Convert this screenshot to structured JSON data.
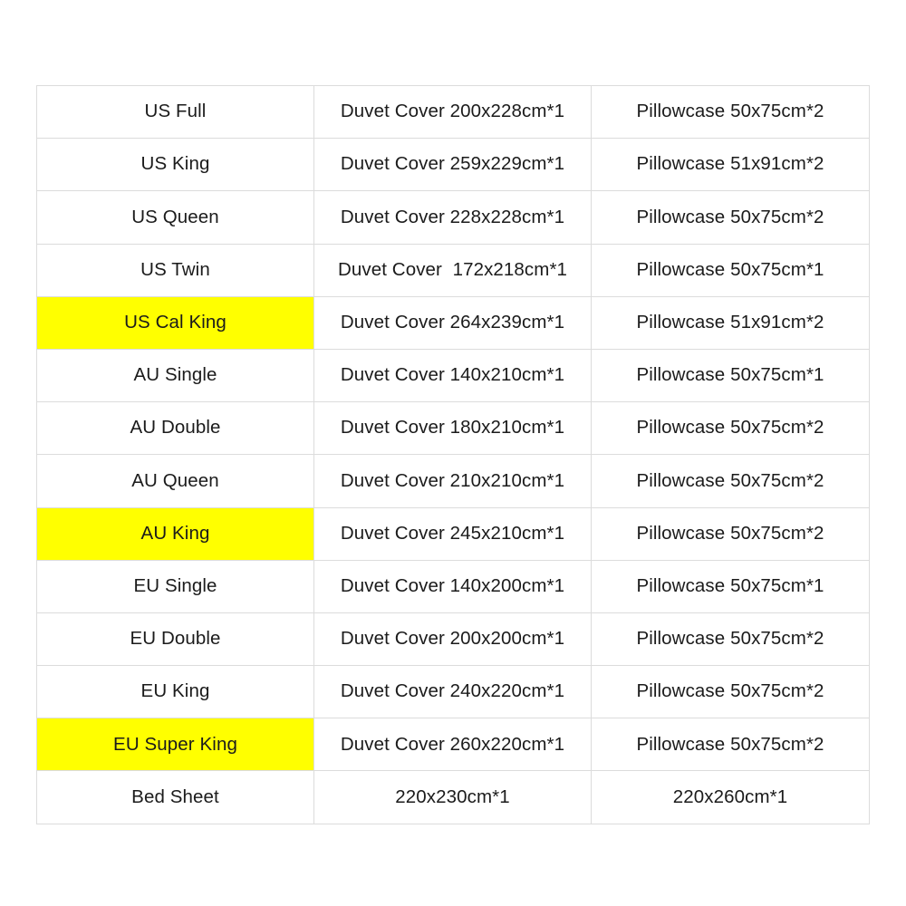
{
  "table": {
    "highlight_color": "#ffff00",
    "border_color": "#dcdcdc",
    "text_color": "#1b1b1b",
    "columns": [
      "size",
      "duvet_cover",
      "pillowcase"
    ],
    "rows": [
      {
        "size": "US Full",
        "duvet_cover": "Duvet Cover 200x228cm*1",
        "pillowcase": "Pillowcase 50x75cm*2",
        "highlighted": false
      },
      {
        "size": "US King",
        "duvet_cover": "Duvet Cover 259x229cm*1",
        "pillowcase": "Pillowcase 51x91cm*2",
        "highlighted": false
      },
      {
        "size": "US Queen",
        "duvet_cover": "Duvet Cover 228x228cm*1",
        "pillowcase": "Pillowcase 50x75cm*2",
        "highlighted": false
      },
      {
        "size": "US Twin",
        "duvet_cover": "Duvet Cover  172x218cm*1",
        "pillowcase": "Pillowcase 50x75cm*1",
        "highlighted": false
      },
      {
        "size": "US Cal King",
        "duvet_cover": "Duvet Cover 264x239cm*1",
        "pillowcase": "Pillowcase 51x91cm*2",
        "highlighted": true
      },
      {
        "size": "AU Single",
        "duvet_cover": "Duvet Cover 140x210cm*1",
        "pillowcase": "Pillowcase 50x75cm*1",
        "highlighted": false
      },
      {
        "size": "AU Double",
        "duvet_cover": "Duvet Cover 180x210cm*1",
        "pillowcase": "Pillowcase 50x75cm*2",
        "highlighted": false
      },
      {
        "size": "AU Queen",
        "duvet_cover": "Duvet Cover 210x210cm*1",
        "pillowcase": "Pillowcase 50x75cm*2",
        "highlighted": false
      },
      {
        "size": "AU King",
        "duvet_cover": "Duvet Cover 245x210cm*1",
        "pillowcase": "Pillowcase 50x75cm*2",
        "highlighted": true
      },
      {
        "size": "EU Single",
        "duvet_cover": "Duvet Cover 140x200cm*1",
        "pillowcase": "Pillowcase 50x75cm*1",
        "highlighted": false
      },
      {
        "size": "EU Double",
        "duvet_cover": "Duvet Cover 200x200cm*1",
        "pillowcase": "Pillowcase 50x75cm*2",
        "highlighted": false
      },
      {
        "size": "EU King",
        "duvet_cover": "Duvet Cover 240x220cm*1",
        "pillowcase": "Pillowcase 50x75cm*2",
        "highlighted": false
      },
      {
        "size": "EU Super King",
        "duvet_cover": "Duvet Cover 260x220cm*1",
        "pillowcase": "Pillowcase 50x75cm*2",
        "highlighted": true
      },
      {
        "size": "Bed Sheet",
        "duvet_cover": "220x230cm*1",
        "pillowcase": "220x260cm*1",
        "highlighted": false
      }
    ]
  }
}
